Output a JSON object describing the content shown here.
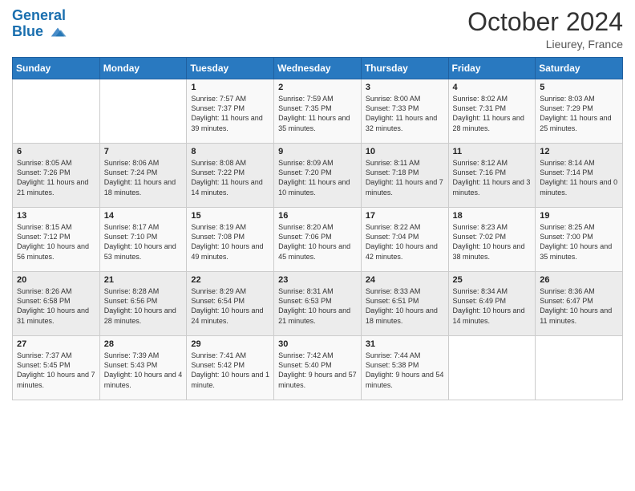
{
  "header": {
    "logo_line1": "General",
    "logo_line2": "Blue",
    "month": "October 2024",
    "location": "Lieurey, France"
  },
  "days_of_week": [
    "Sunday",
    "Monday",
    "Tuesday",
    "Wednesday",
    "Thursday",
    "Friday",
    "Saturday"
  ],
  "weeks": [
    [
      {
        "day": "",
        "text": ""
      },
      {
        "day": "",
        "text": ""
      },
      {
        "day": "1",
        "text": "Sunrise: 7:57 AM\nSunset: 7:37 PM\nDaylight: 11 hours and 39 minutes."
      },
      {
        "day": "2",
        "text": "Sunrise: 7:59 AM\nSunset: 7:35 PM\nDaylight: 11 hours and 35 minutes."
      },
      {
        "day": "3",
        "text": "Sunrise: 8:00 AM\nSunset: 7:33 PM\nDaylight: 11 hours and 32 minutes."
      },
      {
        "day": "4",
        "text": "Sunrise: 8:02 AM\nSunset: 7:31 PM\nDaylight: 11 hours and 28 minutes."
      },
      {
        "day": "5",
        "text": "Sunrise: 8:03 AM\nSunset: 7:29 PM\nDaylight: 11 hours and 25 minutes."
      }
    ],
    [
      {
        "day": "6",
        "text": "Sunrise: 8:05 AM\nSunset: 7:26 PM\nDaylight: 11 hours and 21 minutes."
      },
      {
        "day": "7",
        "text": "Sunrise: 8:06 AM\nSunset: 7:24 PM\nDaylight: 11 hours and 18 minutes."
      },
      {
        "day": "8",
        "text": "Sunrise: 8:08 AM\nSunset: 7:22 PM\nDaylight: 11 hours and 14 minutes."
      },
      {
        "day": "9",
        "text": "Sunrise: 8:09 AM\nSunset: 7:20 PM\nDaylight: 11 hours and 10 minutes."
      },
      {
        "day": "10",
        "text": "Sunrise: 8:11 AM\nSunset: 7:18 PM\nDaylight: 11 hours and 7 minutes."
      },
      {
        "day": "11",
        "text": "Sunrise: 8:12 AM\nSunset: 7:16 PM\nDaylight: 11 hours and 3 minutes."
      },
      {
        "day": "12",
        "text": "Sunrise: 8:14 AM\nSunset: 7:14 PM\nDaylight: 11 hours and 0 minutes."
      }
    ],
    [
      {
        "day": "13",
        "text": "Sunrise: 8:15 AM\nSunset: 7:12 PM\nDaylight: 10 hours and 56 minutes."
      },
      {
        "day": "14",
        "text": "Sunrise: 8:17 AM\nSunset: 7:10 PM\nDaylight: 10 hours and 53 minutes."
      },
      {
        "day": "15",
        "text": "Sunrise: 8:19 AM\nSunset: 7:08 PM\nDaylight: 10 hours and 49 minutes."
      },
      {
        "day": "16",
        "text": "Sunrise: 8:20 AM\nSunset: 7:06 PM\nDaylight: 10 hours and 45 minutes."
      },
      {
        "day": "17",
        "text": "Sunrise: 8:22 AM\nSunset: 7:04 PM\nDaylight: 10 hours and 42 minutes."
      },
      {
        "day": "18",
        "text": "Sunrise: 8:23 AM\nSunset: 7:02 PM\nDaylight: 10 hours and 38 minutes."
      },
      {
        "day": "19",
        "text": "Sunrise: 8:25 AM\nSunset: 7:00 PM\nDaylight: 10 hours and 35 minutes."
      }
    ],
    [
      {
        "day": "20",
        "text": "Sunrise: 8:26 AM\nSunset: 6:58 PM\nDaylight: 10 hours and 31 minutes."
      },
      {
        "day": "21",
        "text": "Sunrise: 8:28 AM\nSunset: 6:56 PM\nDaylight: 10 hours and 28 minutes."
      },
      {
        "day": "22",
        "text": "Sunrise: 8:29 AM\nSunset: 6:54 PM\nDaylight: 10 hours and 24 minutes."
      },
      {
        "day": "23",
        "text": "Sunrise: 8:31 AM\nSunset: 6:53 PM\nDaylight: 10 hours and 21 minutes."
      },
      {
        "day": "24",
        "text": "Sunrise: 8:33 AM\nSunset: 6:51 PM\nDaylight: 10 hours and 18 minutes."
      },
      {
        "day": "25",
        "text": "Sunrise: 8:34 AM\nSunset: 6:49 PM\nDaylight: 10 hours and 14 minutes."
      },
      {
        "day": "26",
        "text": "Sunrise: 8:36 AM\nSunset: 6:47 PM\nDaylight: 10 hours and 11 minutes."
      }
    ],
    [
      {
        "day": "27",
        "text": "Sunrise: 7:37 AM\nSunset: 5:45 PM\nDaylight: 10 hours and 7 minutes."
      },
      {
        "day": "28",
        "text": "Sunrise: 7:39 AM\nSunset: 5:43 PM\nDaylight: 10 hours and 4 minutes."
      },
      {
        "day": "29",
        "text": "Sunrise: 7:41 AM\nSunset: 5:42 PM\nDaylight: 10 hours and 1 minute."
      },
      {
        "day": "30",
        "text": "Sunrise: 7:42 AM\nSunset: 5:40 PM\nDaylight: 9 hours and 57 minutes."
      },
      {
        "day": "31",
        "text": "Sunrise: 7:44 AM\nSunset: 5:38 PM\nDaylight: 9 hours and 54 minutes."
      },
      {
        "day": "",
        "text": ""
      },
      {
        "day": "",
        "text": ""
      }
    ]
  ]
}
